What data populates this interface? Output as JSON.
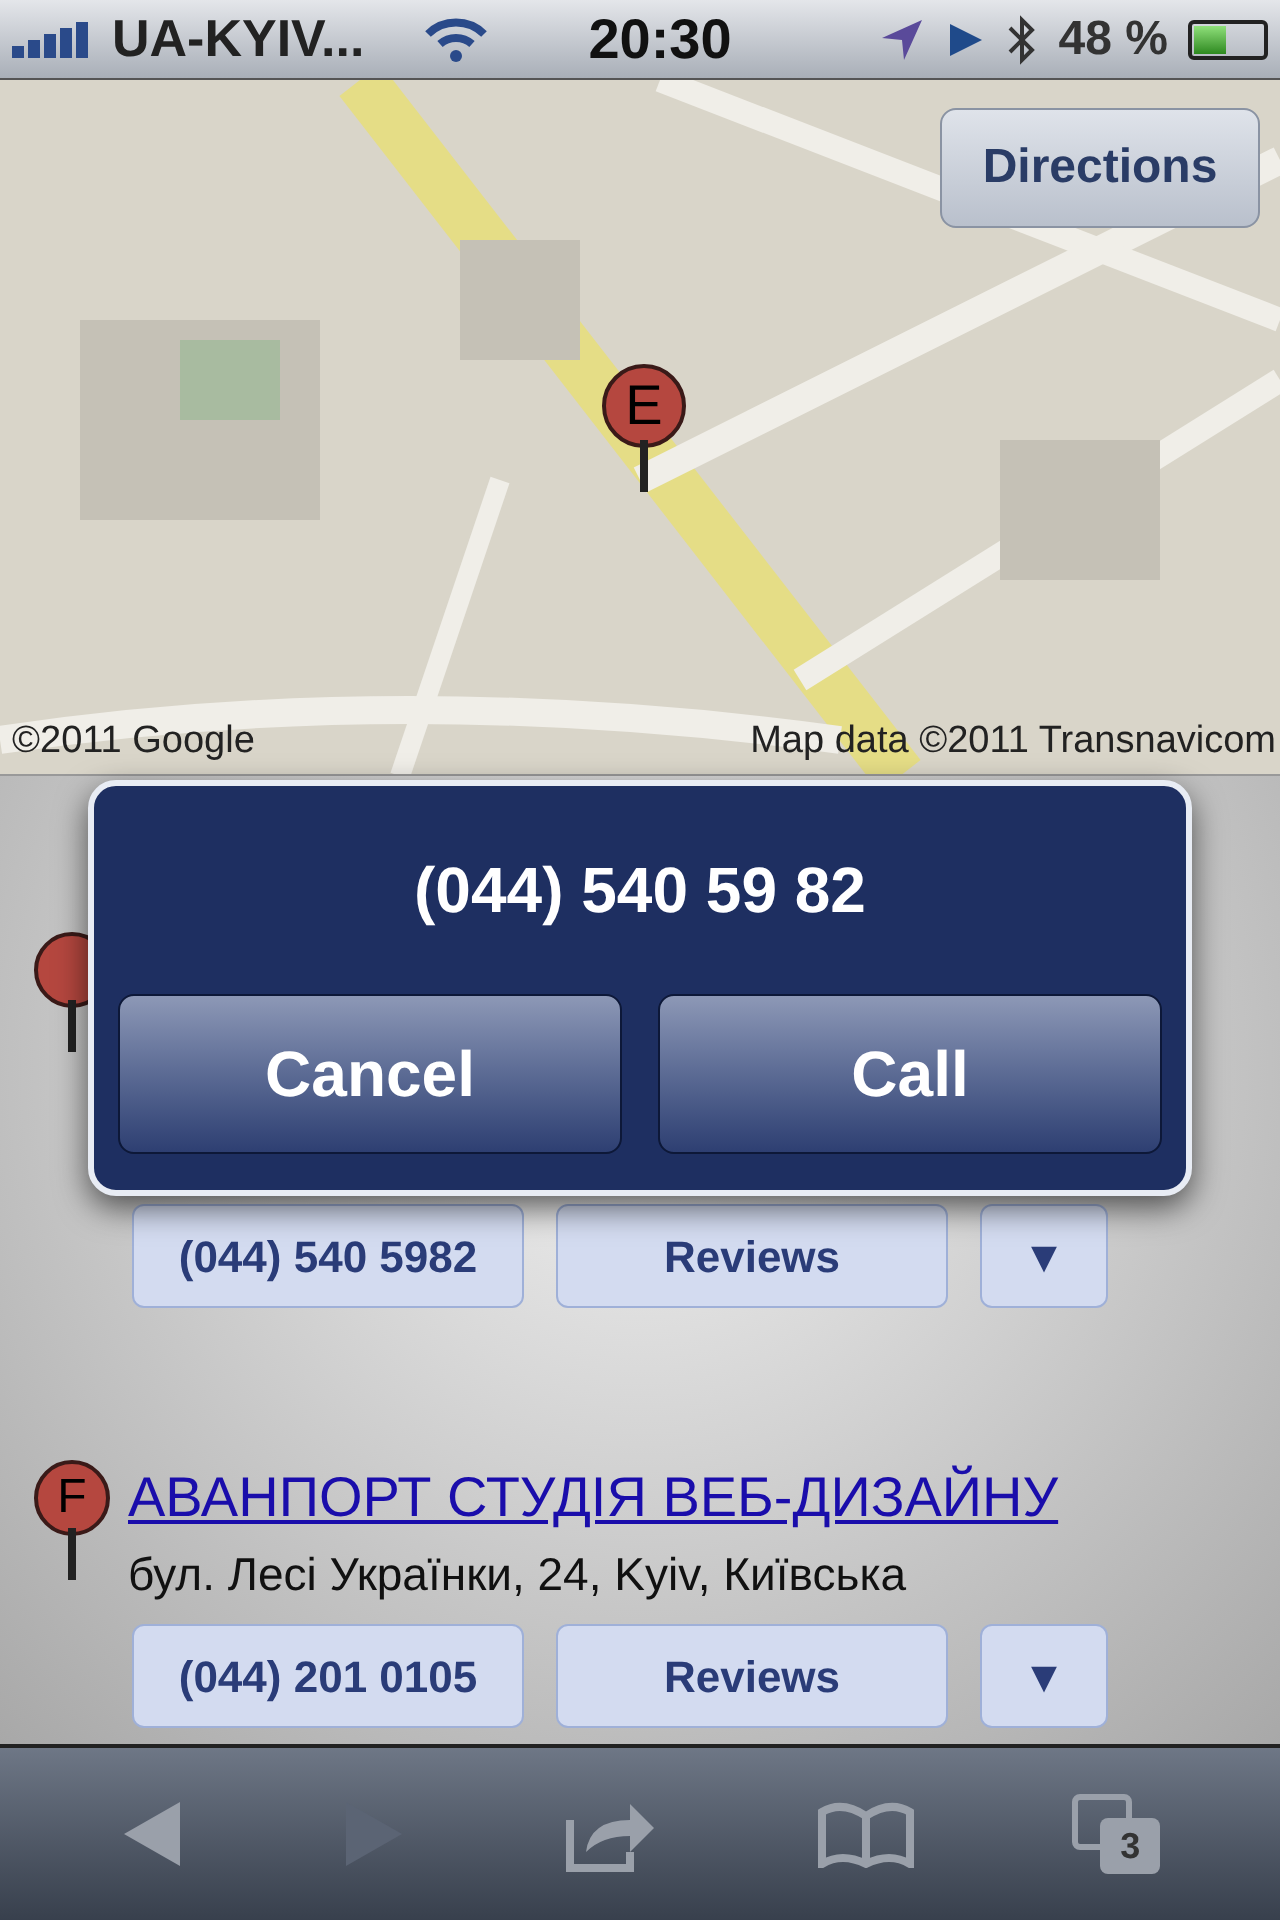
{
  "status_bar": {
    "carrier": "UA-KYIV...",
    "time": "20:30",
    "battery": "48 %"
  },
  "map": {
    "directions_button": "Directions",
    "pin_label": "E",
    "copyright": "©2011 Google",
    "map_data": "Map data ©2011 Transnavicom"
  },
  "results": [
    {
      "phone": "(044) 540 5982",
      "reviews": "Reviews",
      "more": "▼"
    },
    {
      "marker": "F",
      "title": "АВАНПОРТ СТУДІЯ ВЕБ-ДИЗАЙНУ",
      "address": "бул. Лесі Українки, 24, Kyiv, Київська",
      "phone": "(044) 201 0105",
      "reviews": "Reviews",
      "more": "▼"
    }
  ],
  "alert": {
    "title": "(044) 540 59 82",
    "buttons": [
      "Cancel",
      "Call"
    ]
  },
  "toolbar": {
    "back_disabled": false,
    "forward_disabled": true,
    "tab_count": "3"
  }
}
